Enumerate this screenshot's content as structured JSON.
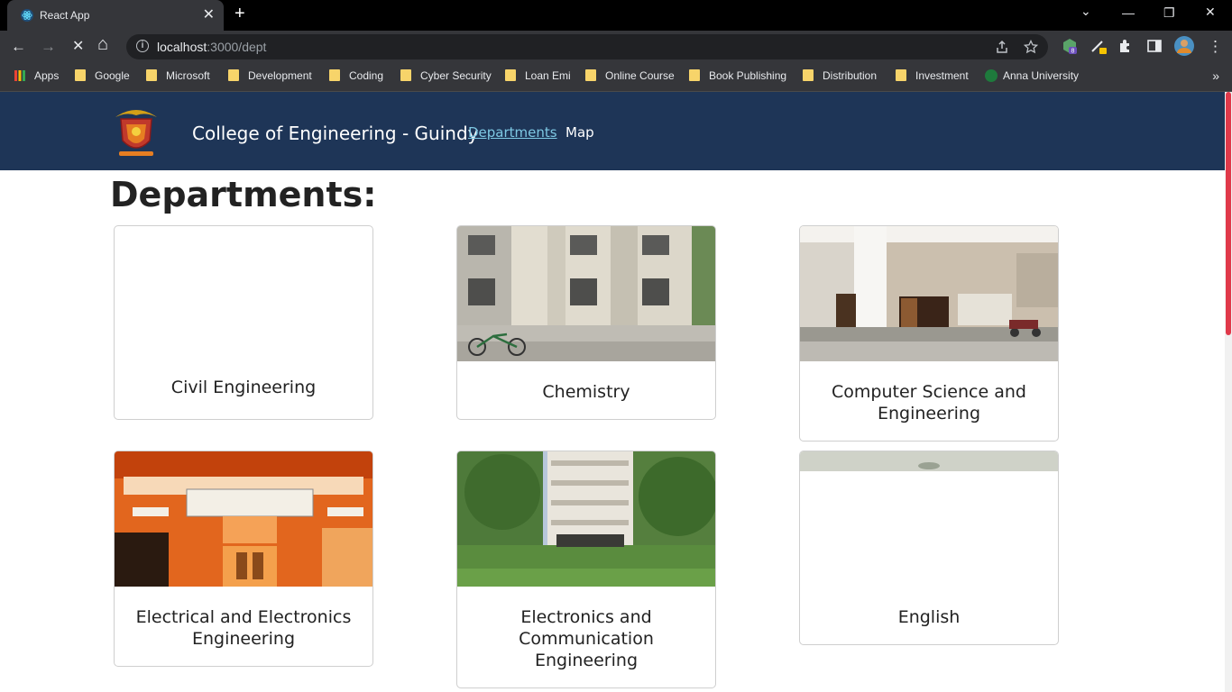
{
  "browser": {
    "tab_title": "React App",
    "tab_close": "✕",
    "new_tab": "+",
    "url_host": "localhost",
    "url_rest": ":3000/dept",
    "info": "i",
    "extension_badge": "8",
    "window_controls": {
      "minimize": "—",
      "restore": "❐",
      "close": "✕",
      "tabs_menu": "⌄"
    },
    "nav": {
      "back": "←",
      "forward": "→",
      "reload": "✕",
      "home": "⌂"
    },
    "bookmarks": [
      {
        "label": "Apps",
        "icon": "apps-grid-icon"
      },
      {
        "label": "Google",
        "icon": "folder-icon"
      },
      {
        "label": "Microsoft",
        "icon": "folder-icon"
      },
      {
        "label": "Development",
        "icon": "folder-icon"
      },
      {
        "label": "Coding",
        "icon": "folder-icon"
      },
      {
        "label": "Cyber Security",
        "icon": "folder-icon"
      },
      {
        "label": "Loan Emi",
        "icon": "folder-icon"
      },
      {
        "label": "Online Course",
        "icon": "folder-icon"
      },
      {
        "label": "Book Publishing",
        "icon": "folder-icon"
      },
      {
        "label": "Distribution",
        "icon": "folder-icon"
      },
      {
        "label": "Investment",
        "icon": "folder-icon"
      },
      {
        "label": "Anna University",
        "icon": "anna-university-icon"
      }
    ],
    "bookmarks_more": "»"
  },
  "site": {
    "brand": "College of Engineering - Guindy",
    "nav": {
      "departments": "Departments",
      "map": "Map"
    },
    "heading": "Departments:"
  },
  "departments": [
    {
      "name": "Civil Engineering",
      "image": "none"
    },
    {
      "name": "Chemistry",
      "image": "building-photo"
    },
    {
      "name": "Computer Science and Engineering",
      "image": "corridor-photo"
    },
    {
      "name": "Electrical and Electronics Engineering",
      "image": "orange-building-photo"
    },
    {
      "name": "Electronics and Communication Engineering",
      "image": "tall-building-photo"
    },
    {
      "name": "English",
      "image": "partial-photo"
    }
  ],
  "colors": {
    "navbar": "#1e3557",
    "active_link": "#7ec8e3",
    "scroll_thumb": "#e0394a"
  }
}
